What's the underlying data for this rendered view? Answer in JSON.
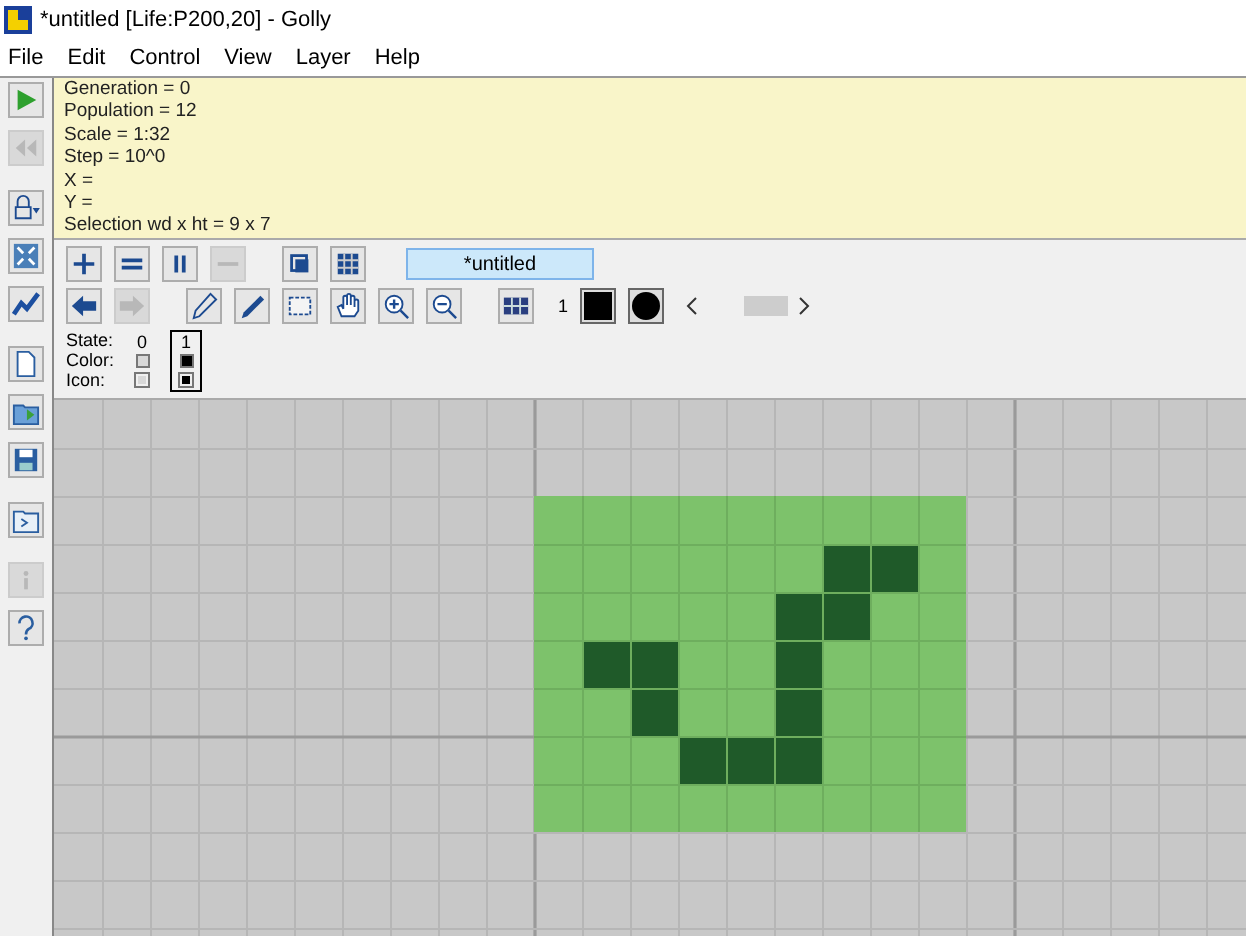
{
  "window": {
    "title": "*untitled [Life:P200,20] - Golly"
  },
  "menu": [
    "File",
    "Edit",
    "Control",
    "View",
    "Layer",
    "Help"
  ],
  "left_toolbar": [
    {
      "kind": "play",
      "disabled": false
    },
    {
      "kind": "reset",
      "disabled": true
    },
    {
      "kind": "algo",
      "disabled": false
    },
    {
      "kind": "fit",
      "disabled": false
    },
    {
      "kind": "speed",
      "disabled": false
    },
    {
      "kind": "new",
      "disabled": false
    },
    {
      "kind": "open",
      "disabled": false
    },
    {
      "kind": "save",
      "disabled": false
    },
    {
      "kind": "scripts",
      "disabled": false
    },
    {
      "kind": "info",
      "disabled": true
    },
    {
      "kind": "help",
      "disabled": false
    }
  ],
  "info_lines": [
    "Generation = 0",
    "Population = 12",
    "Scale = 1:32",
    "Step = 10^0",
    "X =",
    "Y =",
    "Selection wd x ht = 9 x 7"
  ],
  "layer_toolbar": [
    {
      "kind": "add",
      "disabled": false
    },
    {
      "kind": "clone",
      "disabled": false
    },
    {
      "kind": "pause",
      "disabled": false
    },
    {
      "kind": "delete",
      "disabled": true
    },
    {
      "kind": "stack",
      "disabled": false
    },
    {
      "kind": "tile",
      "disabled": false
    }
  ],
  "layer_tabs": [
    {
      "label": "*untitled",
      "selected": true
    }
  ],
  "edit_toolbar": [
    {
      "kind": "undo",
      "disabled": false
    },
    {
      "kind": "redo",
      "disabled": true
    },
    {
      "kind": "draw",
      "disabled": false
    },
    {
      "kind": "pick",
      "disabled": false
    },
    {
      "kind": "select",
      "disabled": false
    },
    {
      "kind": "move",
      "disabled": false
    },
    {
      "kind": "zoomin",
      "disabled": false
    },
    {
      "kind": "zoomout",
      "disabled": false
    },
    {
      "kind": "allstates",
      "disabled": false
    }
  ],
  "current_state": {
    "label": "1",
    "color": "#000000"
  },
  "state_panel": {
    "labels": [
      "State:",
      "Color:",
      "Icon:"
    ],
    "states": [
      {
        "label": "0",
        "selected": false,
        "color": "#d8d8d8"
      },
      {
        "label": "1",
        "selected": true,
        "color": "#000000"
      }
    ]
  },
  "canvas": {
    "selection": {
      "cells": [
        [
          false,
          false,
          false,
          false,
          false,
          false,
          false,
          false,
          false
        ],
        [
          false,
          false,
          false,
          false,
          false,
          false,
          true,
          true,
          false
        ],
        [
          false,
          false,
          false,
          false,
          false,
          true,
          true,
          false,
          false
        ],
        [
          false,
          true,
          true,
          false,
          false,
          true,
          false,
          false,
          false
        ],
        [
          false,
          false,
          true,
          false,
          false,
          true,
          false,
          false,
          false
        ],
        [
          false,
          false,
          false,
          true,
          true,
          true,
          false,
          false,
          false
        ],
        [
          false,
          false,
          false,
          false,
          false,
          false,
          false,
          false,
          false
        ]
      ]
    }
  }
}
